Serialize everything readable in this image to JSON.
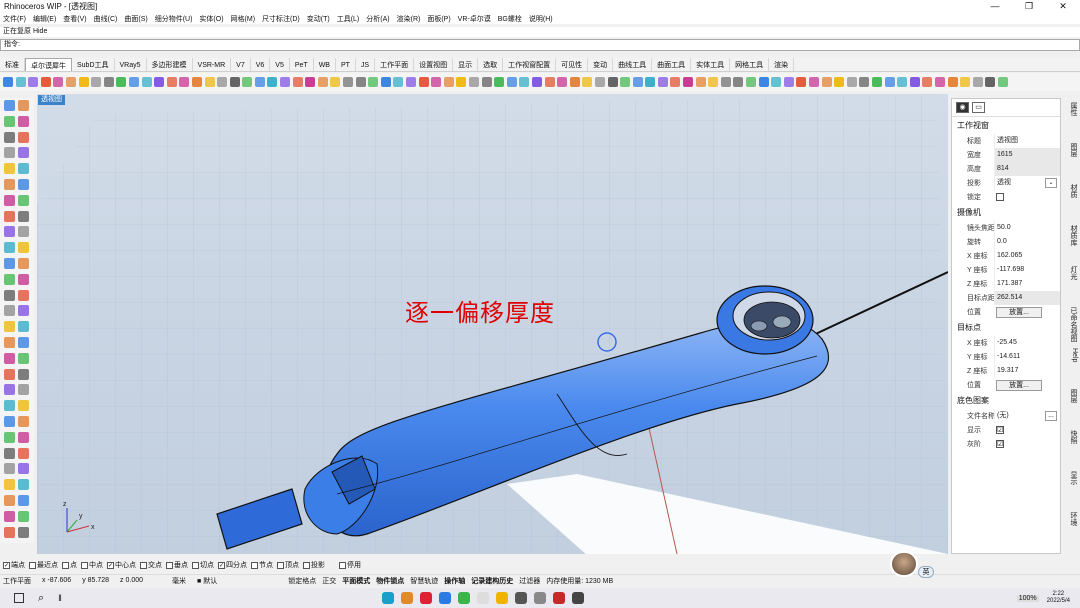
{
  "window": {
    "title": "Rhinoceros WIP - [透视图]",
    "controls": [
      "—",
      "❐",
      "✕"
    ]
  },
  "menu": [
    "文件(F)",
    "编辑(E)",
    "查看(V)",
    "曲线(C)",
    "曲面(S)",
    "细分物件(U)",
    "实体(O)",
    "网格(M)",
    "尺寸标注(D)",
    "变动(T)",
    "工具(L)",
    "分析(A)",
    "渲染(R)",
    "面板(P)",
    "VR-卓尔谟",
    "BG螺栓",
    "说明(H)"
  ],
  "command": {
    "history": "正在复原 Hide",
    "prompt": "指令:",
    "value": ""
  },
  "tabs": [
    "标准",
    "卓尔谟犀牛",
    "SubD工具",
    "VRay5",
    "多边形建模",
    "VSR-MR",
    "V7",
    "V6",
    "V5",
    "PeT",
    "WB",
    "PT",
    "JS",
    "工作平面",
    "设置视图",
    "显示",
    "选取",
    "工作视窗配置",
    "可见性",
    "变动",
    "曲线工具",
    "曲面工具",
    "实体工具",
    "网格工具",
    "渲染"
  ],
  "active_tab": "卓尔谟犀牛",
  "viewport": {
    "label": "透视图",
    "overlay_text": "逐一偏移厚度",
    "axes": [
      "x",
      "y",
      "z"
    ]
  },
  "properties": {
    "tab_icons": [
      "camera-icon",
      "rectangle-icon"
    ],
    "section_viewport": "工作视窗",
    "viewport_rows": [
      {
        "k": "标题",
        "v": "透视图"
      },
      {
        "k": "宽度",
        "v": "1615"
      },
      {
        "k": "高度",
        "v": "814"
      },
      {
        "k": "投影",
        "v": "透视"
      },
      {
        "k": "锁定",
        "v": ""
      }
    ],
    "section_camera": "摄像机",
    "camera_rows": [
      {
        "k": "镜头焦距(…",
        "v": "50.0"
      },
      {
        "k": "旋转",
        "v": "0.0"
      },
      {
        "k": "X 座标",
        "v": "162.065"
      },
      {
        "k": "Y 座标",
        "v": "-117.698"
      },
      {
        "k": "Z 座标",
        "v": "171.387"
      },
      {
        "k": "目标点距离",
        "v": "262.514"
      },
      {
        "k": "位置",
        "v": "放置..."
      }
    ],
    "section_target": "目标点",
    "target_rows": [
      {
        "k": "X 座标",
        "v": "-25.45"
      },
      {
        "k": "Y 座标",
        "v": "-14.611"
      },
      {
        "k": "Z 座标",
        "v": "19.317"
      },
      {
        "k": "位置",
        "v": "放置..."
      }
    ],
    "section_wallpaper": "底色图案",
    "wallpaper_rows": [
      {
        "k": "文件名称",
        "v": "(无)"
      },
      {
        "k": "显示",
        "v": "☑"
      },
      {
        "k": "灰阶",
        "v": "☑"
      }
    ]
  },
  "side_tabs": [
    "属性",
    "图层",
    "材质",
    "材质库",
    "灯光",
    "已命名视图",
    "Help",
    "图层",
    "快照",
    "显示",
    "环境"
  ],
  "osnap": [
    {
      "label": "端点",
      "checked": true
    },
    {
      "label": "最近点",
      "checked": false
    },
    {
      "label": "点",
      "checked": false
    },
    {
      "label": "中点",
      "checked": false
    },
    {
      "label": "中心点",
      "checked": true
    },
    {
      "label": "交点",
      "checked": false
    },
    {
      "label": "垂点",
      "checked": false
    },
    {
      "label": "切点",
      "checked": false
    },
    {
      "label": "四分点",
      "checked": true
    },
    {
      "label": "节点",
      "checked": false
    },
    {
      "label": "顶点",
      "checked": false
    },
    {
      "label": "投影",
      "checked": false
    },
    {
      "label": "停用",
      "checked": false
    }
  ],
  "status": {
    "cplane": "工作平面",
    "x": "x -87.606",
    "y": "y 85.728",
    "z": "z 0.000",
    "unit": "毫米",
    "layer": "默认",
    "toggles": [
      "锁定格点",
      "正交",
      "平面模式",
      "物件锁点",
      "智慧轨迹",
      "操作轴",
      "记录建构历史",
      "过滤器"
    ],
    "memory": "内存使用量: 1230 MB"
  },
  "tray": {
    "time": "2:22",
    "date": "2022/5/4",
    "battery": "100%",
    "ime": "英"
  },
  "colors": {
    "viewport_top": "#d2dce8",
    "object": "#3d7fe6",
    "overlay": "#e00000"
  }
}
